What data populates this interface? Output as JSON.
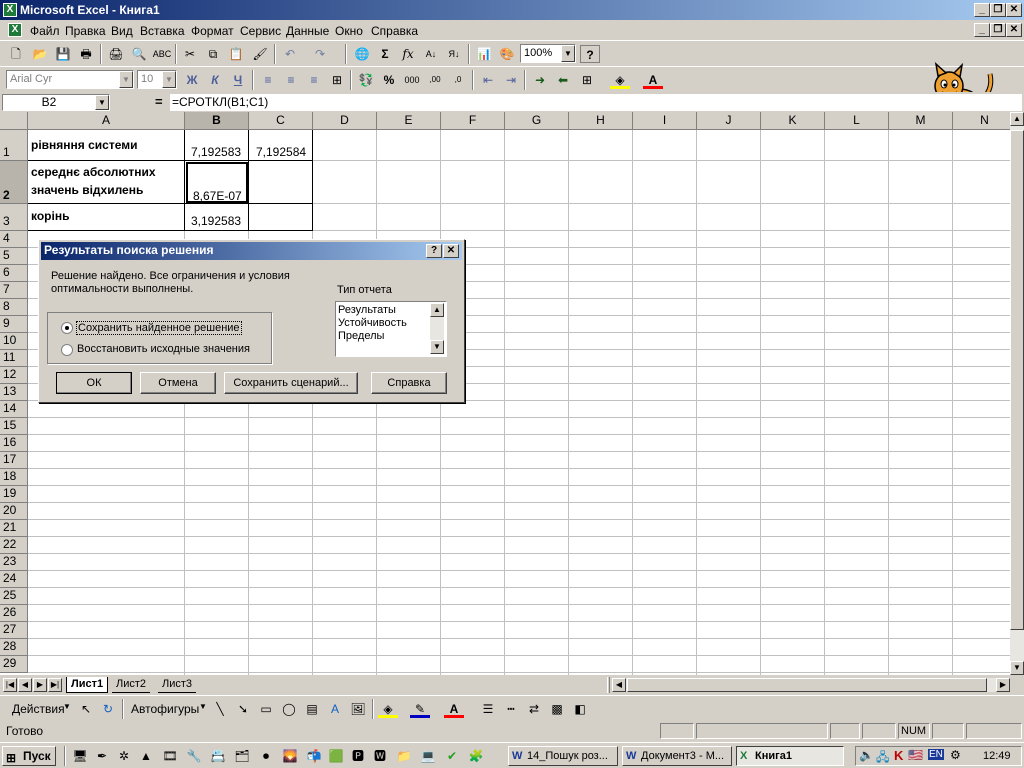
{
  "window": {
    "title": "Microsoft Excel - Книга1",
    "app_icon": "excel-icon",
    "controls": [
      "_",
      "❐",
      "✕"
    ]
  },
  "menu": {
    "items": [
      "Файл",
      "Правка",
      "Вид",
      "Вставка",
      "Формат",
      "Сервис",
      "Данные",
      "Окно",
      "Справка"
    ]
  },
  "standard_toolbar": {
    "zoom": "100%",
    "icons": [
      "new-icon",
      "open-icon",
      "save-icon",
      "permission-icon",
      "print-icon",
      "print-preview-icon",
      "spelling-icon",
      "cut-icon",
      "copy-icon",
      "paste-icon",
      "format-painter-icon",
      "undo-icon",
      "redo-icon",
      "hyperlink-icon",
      "sum-icon",
      "function-icon",
      "sort-asc-icon",
      "sort-desc-icon",
      "chart-wizard-icon",
      "drawing-icon",
      "help-icon"
    ],
    "glyphs": {
      "sum": "Σ",
      "function": "fx",
      "help": "?"
    }
  },
  "formatting_toolbar": {
    "font": "Arial Cyr",
    "size": "10",
    "bold": "Ж",
    "italic": "К",
    "underline": "Ч",
    "percent": "%",
    "thousands": "000"
  },
  "formula_bar": {
    "name_box": "B2",
    "equals": "=",
    "formula": "=СРОТКЛ(B1;C1)"
  },
  "columns": [
    "A",
    "B",
    "C",
    "D",
    "E",
    "F",
    "G",
    "H",
    "I",
    "J",
    "K",
    "L",
    "M",
    "N"
  ],
  "rows": [
    "1",
    "2",
    "3",
    "4",
    "5",
    "6",
    "7",
    "8",
    "9",
    "10",
    "11",
    "12",
    "13",
    "14",
    "15",
    "16",
    "17",
    "18",
    "19",
    "20",
    "21",
    "22",
    "23",
    "24",
    "25",
    "26",
    "27",
    "28",
    "29"
  ],
  "cells": {
    "A1": "рівняння системи",
    "B1": "7,192583",
    "C1": "7,192584",
    "A2_line1": "середнє абсолютних",
    "A2_line2": "значень відхилень",
    "B2": "8,67E-07",
    "A3": "корінь",
    "B3": "3,192583"
  },
  "sheet_tabs": [
    "Лист1",
    "Лист2",
    "Лист3"
  ],
  "drawing_toolbar": {
    "actions": "Действия",
    "autoshapes": "Автофигуры"
  },
  "status": {
    "ready": "Готово",
    "num": "NUM"
  },
  "taskbar": {
    "start": "Пуск",
    "tasks": [
      "14_Пошук роз...",
      "Документ3 - М...",
      "Книга1"
    ],
    "clock": "12:49",
    "lang": "EN"
  },
  "dialog": {
    "title": "Результаты поиска решения",
    "message_line1": "Решение найдено. Все ограничения и условия",
    "message_line2": "оптимальности выполнены.",
    "option_keep": "Сохранить найденное решение",
    "option_restore": "Восстановить исходные значения",
    "report_label": "Тип отчета",
    "reports": [
      "Результаты",
      "Устойчивость",
      "Пределы"
    ],
    "btn_ok": "ОК",
    "btn_cancel": "Отмена",
    "btn_save_scenario": "Сохранить сценарий...",
    "btn_help": "Справка",
    "help_glyph": "?",
    "close_glyph": "✕"
  }
}
